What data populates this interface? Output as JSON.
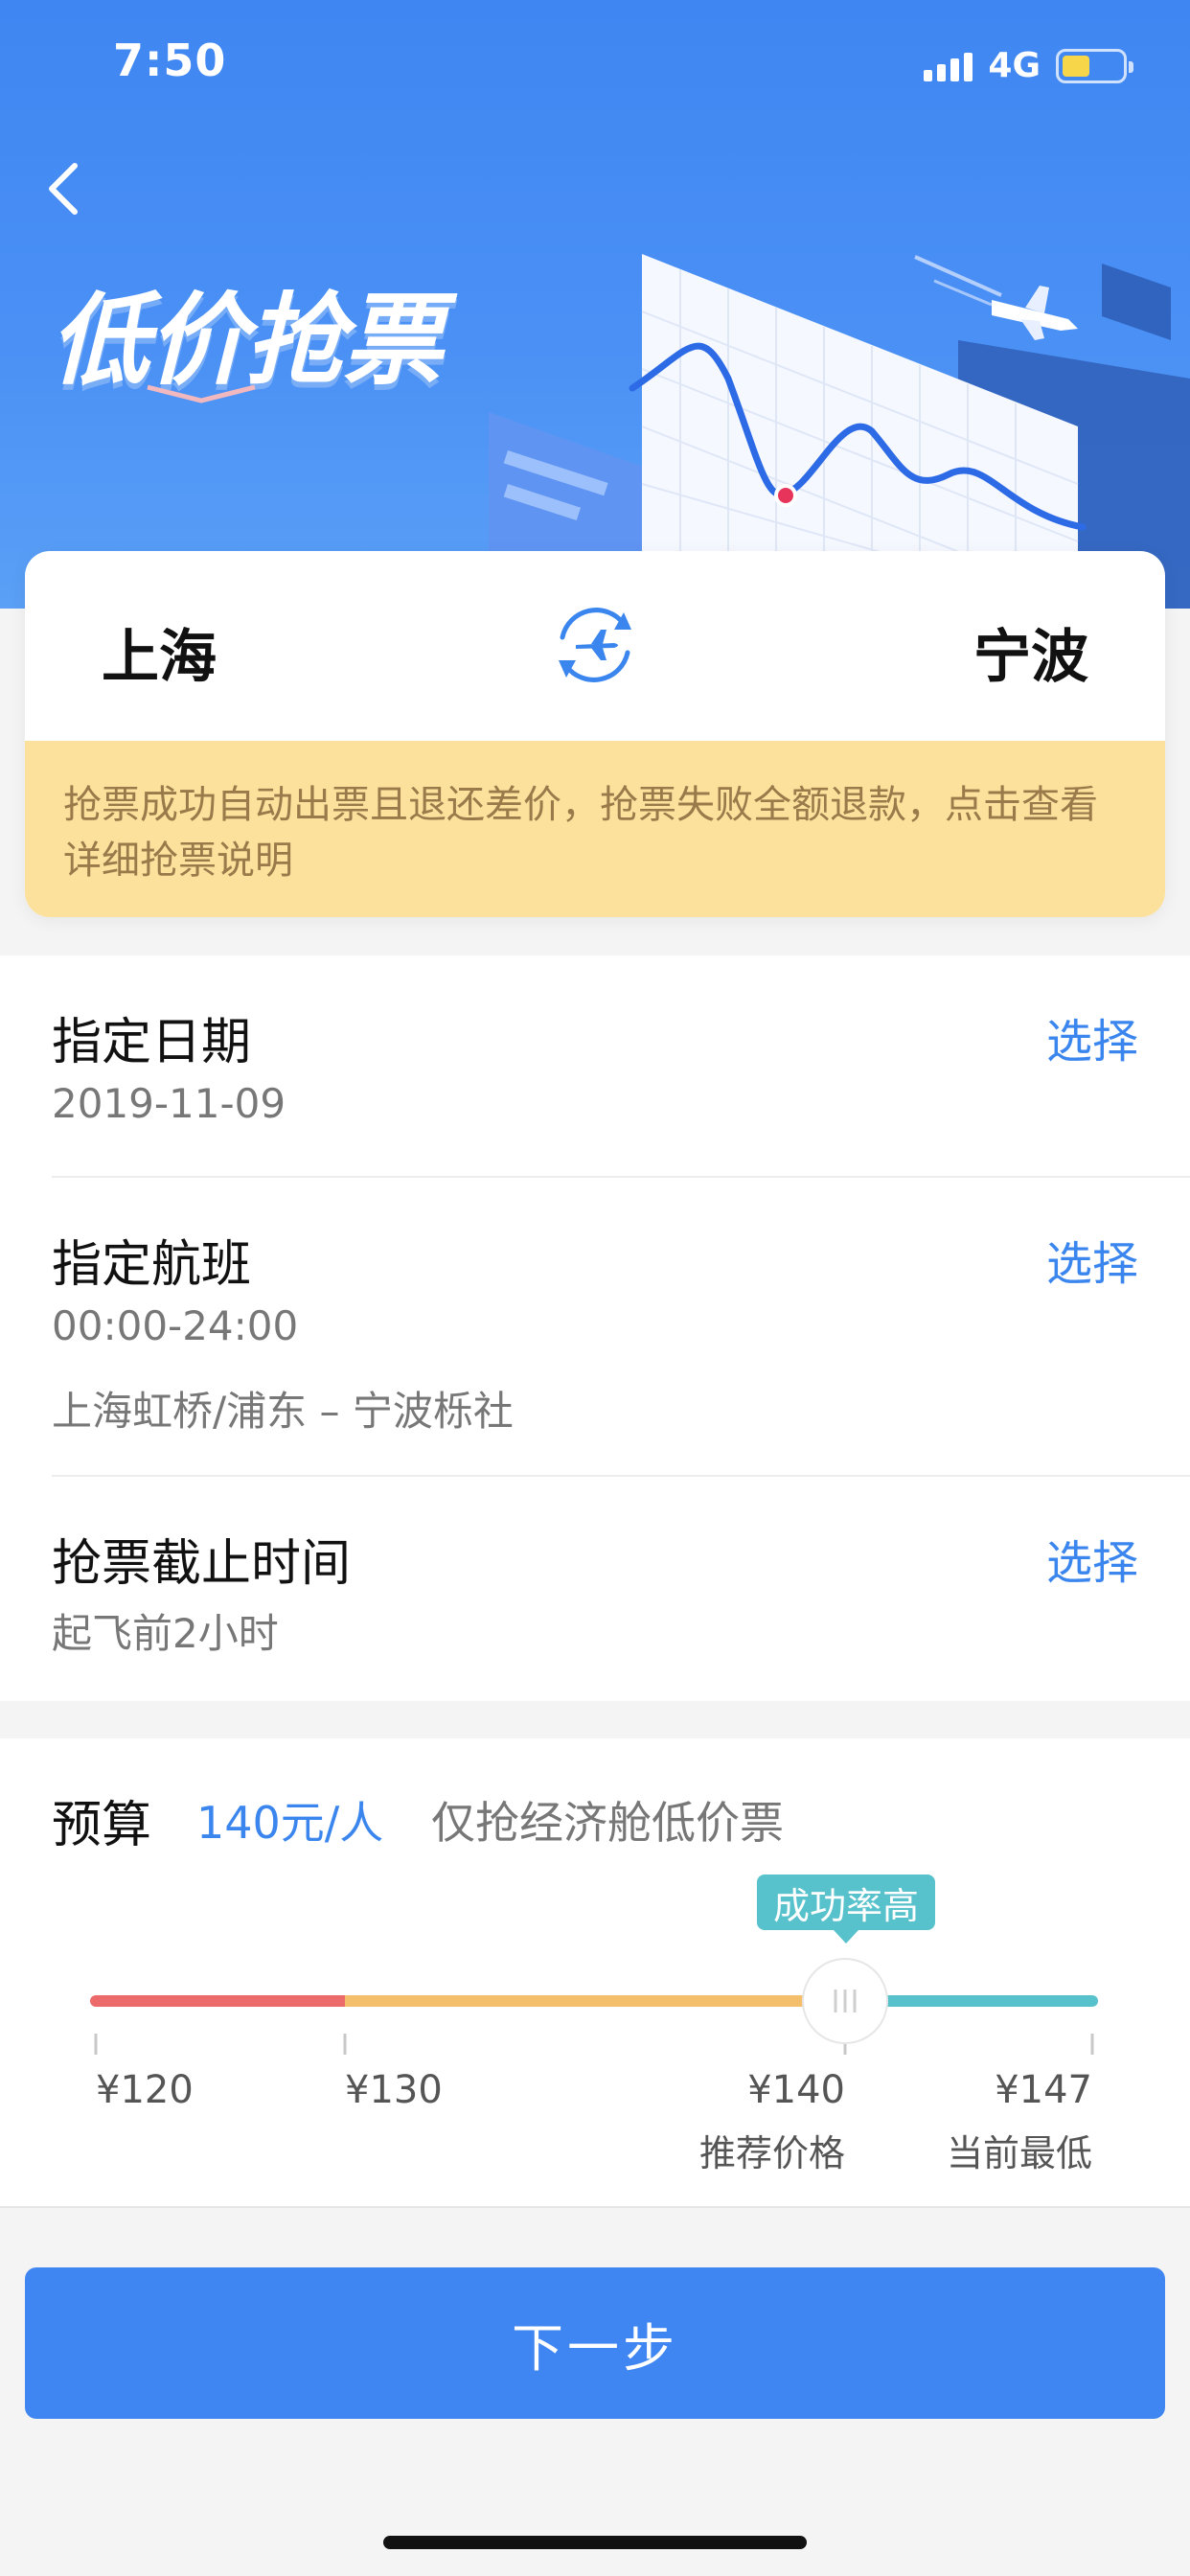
{
  "status": {
    "time": "7:50",
    "network": "4G"
  },
  "header": {
    "title": "低价抢票"
  },
  "route": {
    "from": "上海",
    "to": "宁波"
  },
  "notice": "抢票成功自动出票且退还差价，抢票失败全额退款，点击查看详细抢票说明",
  "options": [
    {
      "title": "指定日期",
      "lines": [
        "2019-11-09"
      ],
      "action": "选择"
    },
    {
      "title": "指定航班",
      "lines": [
        "00:00-24:00",
        "上海虹桥/浦东 – 宁波栎社"
      ],
      "action": "选择"
    },
    {
      "title": "抢票截止时间",
      "lines": [
        "起飞前2小时"
      ],
      "action": "选择"
    }
  ],
  "budget": {
    "label": "预算",
    "value": "140元/人",
    "note": "仅抢经济舱低价票",
    "tooltip": "成功率高",
    "selected_price": 140,
    "scale": {
      "min": 120,
      "max": 147
    },
    "segments": [
      {
        "from": 120,
        "to": 130,
        "color": "#ec6a6a"
      },
      {
        "from": 130,
        "to": 140,
        "color": "#f3bf6b"
      },
      {
        "from": 140,
        "to": 147,
        "color": "#58c2cc"
      }
    ],
    "ticks": [
      {
        "value": 120,
        "label": "¥120",
        "sub": ""
      },
      {
        "value": 130,
        "label": "¥130",
        "sub": ""
      },
      {
        "value": 140,
        "label": "¥140",
        "sub": "推荐价格"
      },
      {
        "value": 147,
        "label": "¥147",
        "sub": "当前最低"
      }
    ]
  },
  "next_button": "下一步",
  "colors": {
    "primary": "#3f86f2",
    "link": "#3a86ee",
    "notice_bg": "#fbe19c",
    "notice_text": "#9a7a4a",
    "tooltip": "#58c2cc"
  }
}
